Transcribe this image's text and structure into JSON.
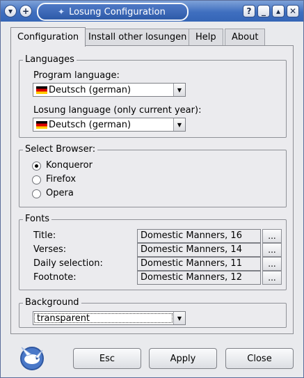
{
  "window": {
    "title": "Losung Configuration"
  },
  "titlebar_buttons": {
    "menu": "▾",
    "sticky": "+",
    "help": "?",
    "minimize": "_",
    "maximize": "▴",
    "close": "✕"
  },
  "tabs": [
    {
      "label": "Configuration"
    },
    {
      "label": "Install other losungen"
    },
    {
      "label": "Help"
    },
    {
      "label": "About"
    }
  ],
  "languages": {
    "title": "Languages",
    "program_label": "Program language:",
    "program_value": "Deutsch (german)",
    "losung_label": "Losung language (only current year):",
    "losung_value": "Deutsch (german)"
  },
  "browser": {
    "title": "Select Browser:",
    "options": [
      {
        "label": "Konqueror",
        "selected": true
      },
      {
        "label": "Firefox",
        "selected": false
      },
      {
        "label": "Opera",
        "selected": false
      }
    ]
  },
  "fonts": {
    "title": "Fonts",
    "rows": [
      {
        "label": "Title:",
        "value": "Domestic Manners, 16",
        "button": "..."
      },
      {
        "label": "Verses:",
        "value": "Domestic Manners, 14",
        "button": "..."
      },
      {
        "label": "Daily selection:",
        "value": "Domestic Manners, 11",
        "button": "..."
      },
      {
        "label": "Footnote:",
        "value": "Domestic Manners, 12",
        "button": "..."
      }
    ]
  },
  "background": {
    "title": "Background",
    "value": "transparent"
  },
  "buttons": {
    "esc": "Esc",
    "apply": "Apply",
    "close": "Close"
  },
  "icons": {
    "app": "dove-logo-icon",
    "combo_arrow": "▼"
  }
}
